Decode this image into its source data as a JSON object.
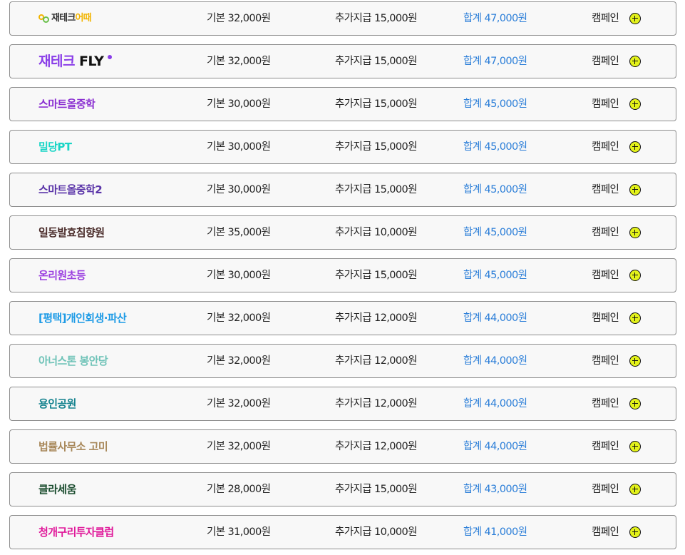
{
  "rows": [
    {
      "brand_a": "재테크",
      "brand_b": "어때",
      "logo": "jaetech",
      "color": "#333333",
      "base": "기본 32,000원",
      "extra": "추가지급 15,000원",
      "total": "합계 47,000원",
      "campaign": "캠페인"
    },
    {
      "brand_a": "재테크",
      "brand_b": "FLY",
      "logo": "fly",
      "color": "#8a3ee8",
      "base": "기본 32,000원",
      "extra": "추가지급 15,000원",
      "total": "합계 47,000원",
      "campaign": "캠페인"
    },
    {
      "brand": "스마트올중학",
      "color": "#8a2fd1",
      "base": "기본 30,000원",
      "extra": "추가지급 15,000원",
      "total": "합계 45,000원",
      "campaign": "캠페인"
    },
    {
      "brand": "밀당PT",
      "color": "#19d5c6",
      "base": "기본 30,000원",
      "extra": "추가지급 15,000원",
      "total": "합계 45,000원",
      "campaign": "캠페인"
    },
    {
      "brand": "스마트올중학2",
      "color": "#5a34a8",
      "base": "기본 30,000원",
      "extra": "추가지급 15,000원",
      "total": "합계 45,000원",
      "campaign": "캠페인"
    },
    {
      "brand": "일동발효침향원",
      "color": "#4a2c2a",
      "base": "기본 35,000원",
      "extra": "추가지급 10,000원",
      "total": "합계 45,000원",
      "campaign": "캠페인"
    },
    {
      "brand": "온리원초등",
      "color": "#9b3ee0",
      "base": "기본 30,000원",
      "extra": "추가지급 15,000원",
      "total": "합계 45,000원",
      "campaign": "캠페인"
    },
    {
      "brand": "[평택]개인회생·파산",
      "color": "#1e9be6",
      "base": "기본 32,000원",
      "extra": "추가지급 12,000원",
      "total": "합계 44,000원",
      "campaign": "캠페인"
    },
    {
      "brand": "아너스톤 봉안당",
      "color": "#6fc3b8",
      "base": "기본 32,000원",
      "extra": "추가지급 12,000원",
      "total": "합계 44,000원",
      "campaign": "캠페인"
    },
    {
      "brand": "용인공원",
      "color": "#16838f",
      "base": "기본 32,000원",
      "extra": "추가지급 12,000원",
      "total": "합계 44,000원",
      "campaign": "캠페인"
    },
    {
      "brand": "법률사무소 고미",
      "color": "#a8885a",
      "base": "기본 32,000원",
      "extra": "추가지급 12,000원",
      "total": "합계 44,000원",
      "campaign": "캠페인"
    },
    {
      "brand": "클라세움",
      "color": "#1b4d2f",
      "base": "기본 28,000원",
      "extra": "추가지급 15,000원",
      "total": "합계 43,000원",
      "campaign": "캠페인"
    },
    {
      "brand": "청개구리투자클럽",
      "color": "#e0199a",
      "base": "기본 31,000원",
      "extra": "추가지급 10,000원",
      "total": "합계 41,000원",
      "campaign": "캠페인"
    }
  ],
  "colors": {
    "total_text": "#2b7ed8",
    "plus_button_fill": "#e3f21a",
    "row_border": "#8e8e8e",
    "row_background": "#f8f8f8"
  },
  "icons": {
    "campaign_button": "plus-circle-icon"
  }
}
